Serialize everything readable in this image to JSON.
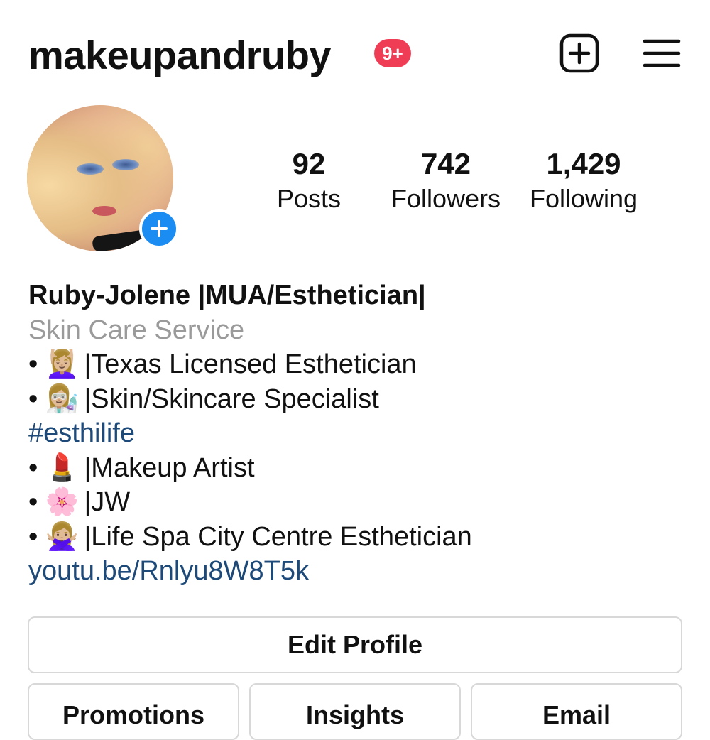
{
  "header": {
    "username": "makeupandruby",
    "notification_badge": "9+",
    "icons": [
      "new-post-icon",
      "hamburger-menu-icon"
    ]
  },
  "profile": {
    "avatar_icon": "profile-photo",
    "add_story_icon": "plus-icon"
  },
  "stats": [
    {
      "value": "92",
      "label": "Posts"
    },
    {
      "value": "742",
      "label": "Followers"
    },
    {
      "value": "1,429",
      "label": "Following"
    }
  ],
  "bio": {
    "name": "Ruby-Jolene |MUA/Esthetician|",
    "category": "Skin Care Service",
    "lines": [
      {
        "bullet": "•",
        "emoji": "💆🏼‍♀️",
        "text": "|Texas Licensed Esthetician"
      },
      {
        "bullet": "•",
        "emoji": "👩🏼‍🔬",
        "text": "|Skin/Skincare Specialist"
      }
    ],
    "hashtag": "#esthilife",
    "lines2": [
      {
        "bullet": "•",
        "emoji": "💄",
        "text": "|Makeup Artist"
      },
      {
        "bullet": "•",
        "emoji": "🌸",
        "text": "|JW"
      },
      {
        "bullet": "•",
        "emoji": "🙅🏼‍♀️",
        "text": "|Life Spa City Centre Esthetician"
      }
    ],
    "link": "youtu.be/Rnlyu8W8T5k"
  },
  "buttons": {
    "edit_profile": "Edit Profile",
    "promotions": "Promotions",
    "insights": "Insights",
    "email": "Email"
  },
  "colors": {
    "badge": "#ef3d55",
    "add_story": "#1a8cf2",
    "link": "#1e4a7a",
    "category": "#9a9a9a"
  }
}
